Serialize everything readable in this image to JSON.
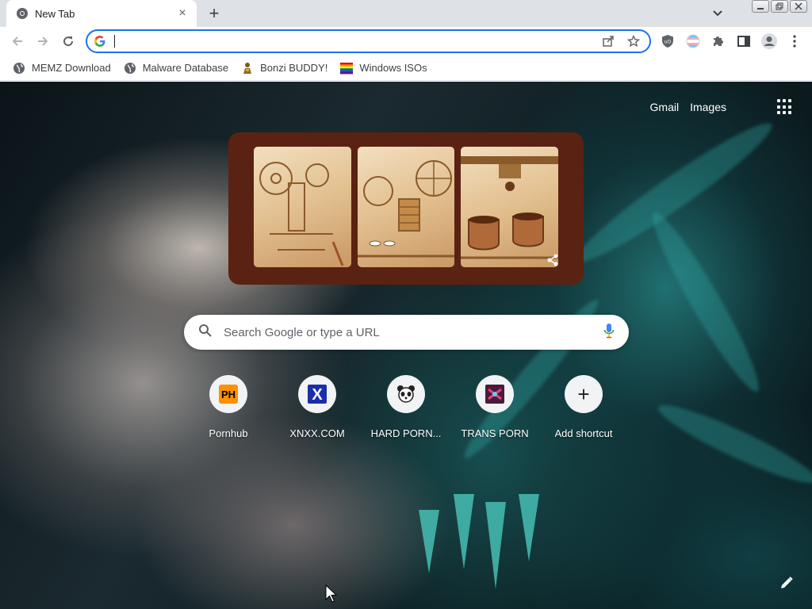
{
  "tab": {
    "title": "New Tab",
    "close_glyph": "×"
  },
  "new_tab_glyph": "+",
  "omnibox": {
    "value": "",
    "placeholder": ""
  },
  "bookmarks": [
    {
      "label": "MEMZ Download",
      "icon": "globe-icon"
    },
    {
      "label": "Malware Database",
      "icon": "globe-icon"
    },
    {
      "label": "Bonzi BUDDY!",
      "icon": "bonzi-icon"
    },
    {
      "label": "Windows ISOs",
      "icon": "rainbow-flag-icon"
    }
  ],
  "top_links": {
    "gmail": "Gmail",
    "images": "Images"
  },
  "search": {
    "placeholder": "Search Google or type a URL"
  },
  "shortcuts": [
    {
      "label": "Pornhub",
      "icon_text": "PH"
    },
    {
      "label": "XNXX.COM",
      "icon_text": "X"
    },
    {
      "label": "HARD PORN...",
      "icon_text": ""
    },
    {
      "label": "TRANS PORN",
      "icon_text": ""
    },
    {
      "label": "Add shortcut",
      "icon_text": "+"
    }
  ],
  "colors": {
    "accent": "#1a73e8",
    "doodle_frame": "#5a2212",
    "tabstrip": "#dee1e6"
  }
}
